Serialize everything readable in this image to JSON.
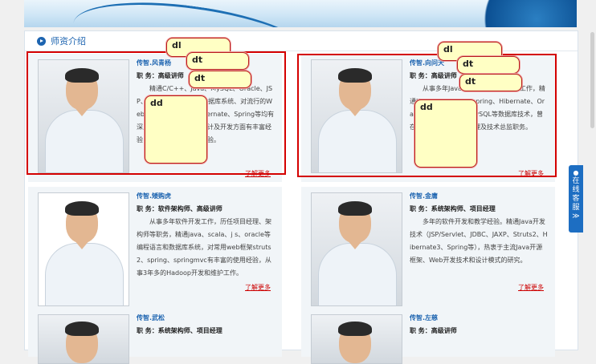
{
  "section": {
    "title": "师资介绍"
  },
  "teachers": [
    {
      "name": "传智.风青杨",
      "role": "职 务：高级讲师",
      "desc": "精通C/C++、Java、MySQL、Oracle、JSP、Servlet等，有多年数据库系统、对流行的Web应用框架Struts、Hibernate、Spring等均有深入研究，在数据库的设计及开发方面有丰富经验，有非常丰富的开发经验。",
      "more": "了解更多"
    },
    {
      "name": "传智.向问天",
      "role": "职 务：高级讲师",
      "desc": "从事多年Java软件开发及相关教学工作，精通J2EE、Struts1,2、spring、Hibernate、Oracle、SQLServer、MySQL等数据库技术，曾在多家公司担任项目经理及技术总监职务。",
      "more": "了解更多"
    },
    {
      "name": "传智.矮购虎",
      "role": "职 务：软件架构师、高级讲师",
      "desc": "从事多年软件开发工作，历任项目经理、架构师等职务，精通java、scala、j s、oracle等编程语言和数据库系统，对常用web框架struts2、spring、springmvc有丰富的使用经验，从事3年多的Hadoop开发和维护工作。",
      "more": "了解更多"
    },
    {
      "name": "传智.金庸",
      "role": "职 务：系统架构师、项目经理",
      "desc": "多年的软件开发和教学经验。精通Java开发技术（JSP/Servlet、JDBC、JAXP、Struts2、Hibernate3、Spring等），热衷于主流Java开源框架、Web开发技术和设计模式的研究。",
      "more": "了解更多"
    },
    {
      "name": "传智.武松",
      "role": "职 务：系统架构师、项目经理",
      "desc": "",
      "more": ""
    },
    {
      "name": "传智.左慈",
      "role": "职 务：高级讲师",
      "desc": "",
      "more": ""
    }
  ],
  "tips": {
    "dl": "dl",
    "dt": "dt",
    "dd": "dd"
  },
  "service": {
    "label": "在线客服",
    "arrow": "≫"
  }
}
